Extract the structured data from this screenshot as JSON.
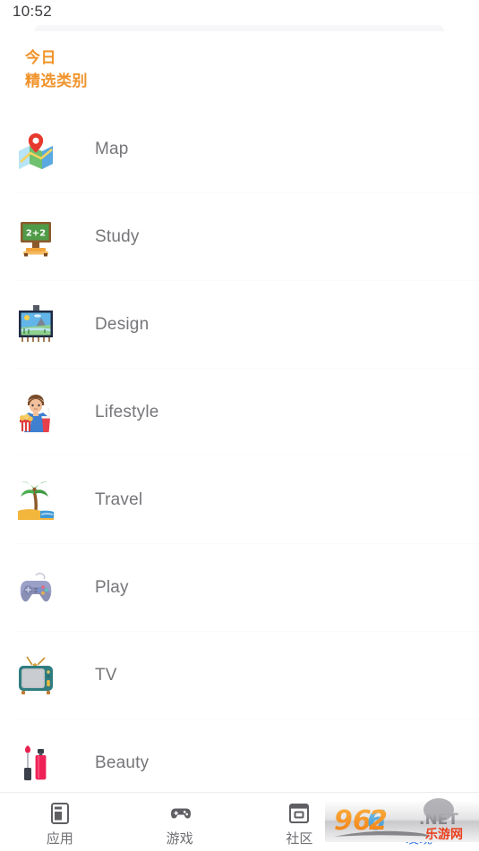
{
  "status": {
    "time": "10:52"
  },
  "header": {
    "line1": "今日",
    "line2": "精选类别",
    "color": "#f0932b"
  },
  "categories": [
    {
      "label": "Map",
      "icon": "map-icon"
    },
    {
      "label": "Study",
      "icon": "chalkboard-icon"
    },
    {
      "label": "Design",
      "icon": "framed-picture-icon"
    },
    {
      "label": "Lifestyle",
      "icon": "person-snacks-icon"
    },
    {
      "label": "Travel",
      "icon": "palm-beach-icon"
    },
    {
      "label": "Play",
      "icon": "game-controller-icon"
    },
    {
      "label": "TV",
      "icon": "television-icon"
    },
    {
      "label": "Beauty",
      "icon": "lipstick-icon"
    }
  ],
  "bottom_nav": {
    "active_color": "#3b7de0",
    "inactive_color": "#6f6f73",
    "items": [
      {
        "label": "应用",
        "icon": "apps-icon",
        "active": false
      },
      {
        "label": "游戏",
        "icon": "gamepad-icon",
        "active": false
      },
      {
        "label": "社区",
        "icon": "community-icon",
        "active": false
      },
      {
        "label": "发现",
        "icon": "search-icon",
        "active": true
      }
    ]
  },
  "watermark": {
    "number": "962",
    "suffix": ".NET",
    "chinese": "乐游网"
  }
}
